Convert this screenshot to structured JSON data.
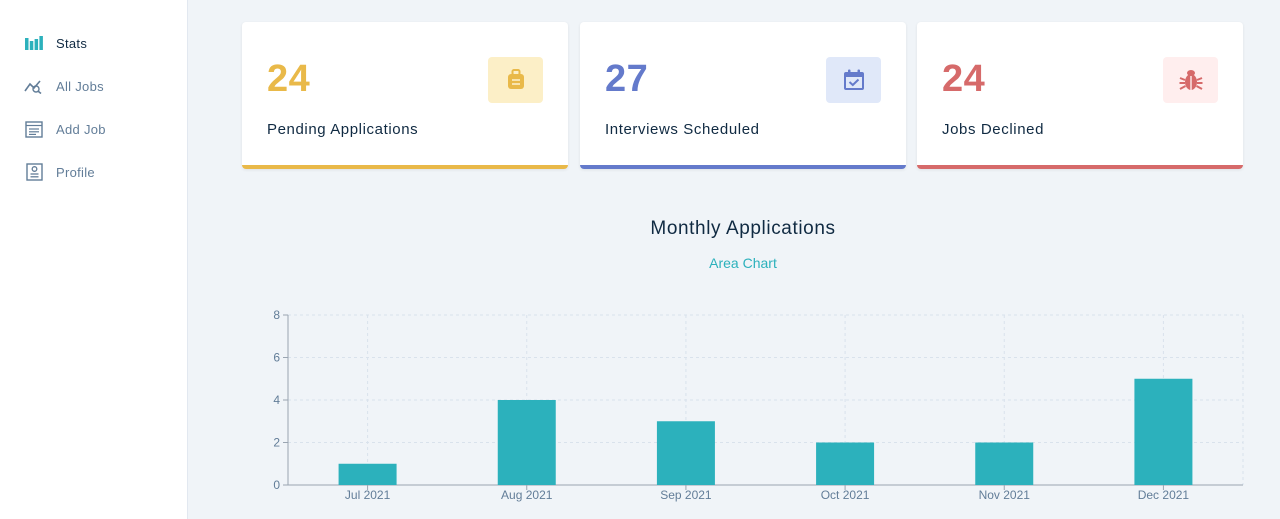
{
  "sidebar": {
    "items": [
      {
        "label": "Stats",
        "icon": "bar-chart-icon"
      },
      {
        "label": "All Jobs",
        "icon": "query-stats-icon"
      },
      {
        "label": "Add Job",
        "icon": "form-icon"
      },
      {
        "label": "Profile",
        "icon": "profile-icon"
      }
    ]
  },
  "stats": [
    {
      "count": "24",
      "label": "Pending Applications",
      "icon": "suitcase-icon",
      "color": "#e9b949",
      "bg": "#fcefc7"
    },
    {
      "count": "27",
      "label": "Interviews Scheduled",
      "icon": "calendar-check-icon",
      "color": "#647acb",
      "bg": "#e0e8f9"
    },
    {
      "count": "24",
      "label": "Jobs Declined",
      "icon": "bug-icon",
      "color": "#d66a6a",
      "bg": "#ffeeee"
    }
  ],
  "chart": {
    "title": "Monthly Applications",
    "toggle_label": "Area Chart"
  },
  "chart_data": {
    "type": "bar",
    "categories": [
      "Jul 2021",
      "Aug 2021",
      "Sep 2021",
      "Oct 2021",
      "Nov 2021",
      "Dec 2021"
    ],
    "values": [
      1,
      4,
      3,
      2,
      2,
      5
    ],
    "ylim": [
      0,
      8
    ],
    "yticks": [
      0,
      2,
      4,
      6,
      8
    ],
    "grid": true,
    "bar_color": "#2cb1bc"
  }
}
